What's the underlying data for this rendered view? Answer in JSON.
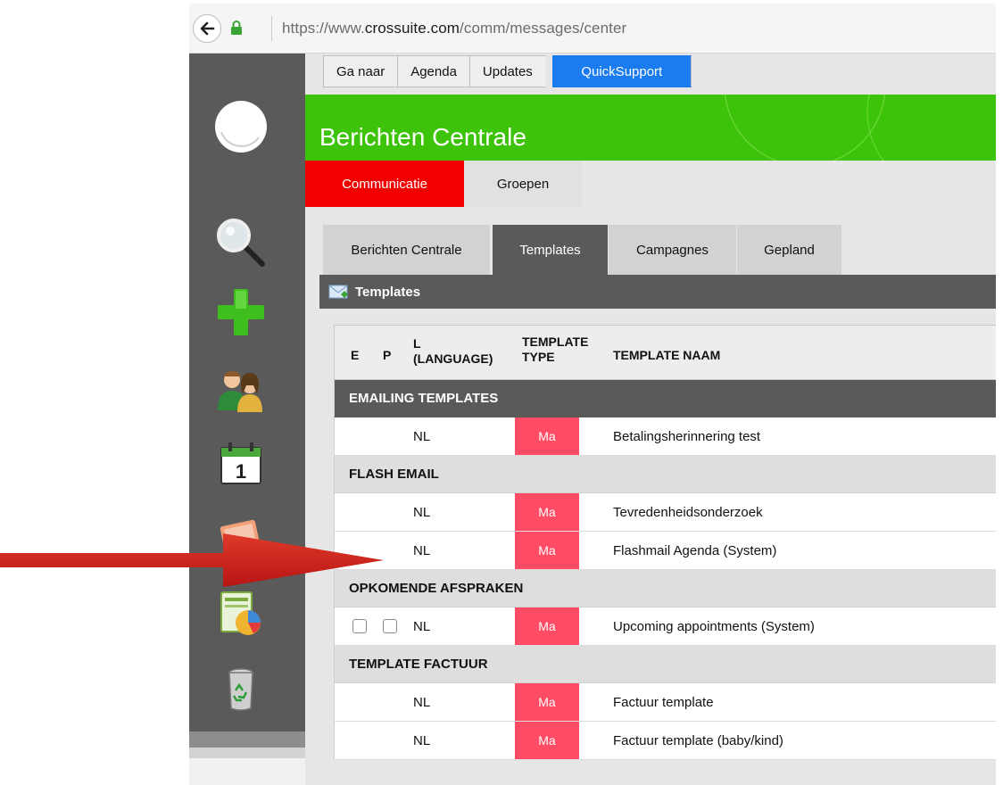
{
  "browser": {
    "url_prefix": "https://www.",
    "url_domain": "crossuite.com",
    "url_path": "/comm/messages/center"
  },
  "topmenu": {
    "items": [
      "Ga naar",
      "Agenda",
      "Updates"
    ],
    "quicksupport": "QuickSupport"
  },
  "banner": {
    "title": "Berichten Centrale"
  },
  "module_tabs": {
    "communicatie": "Communicatie",
    "groepen": "Groepen"
  },
  "sub_tabs": {
    "berichten": "Berichten Centrale",
    "templates": "Templates",
    "campagnes": "Campagnes",
    "gepland": "Gepland"
  },
  "panel": {
    "title": "Templates"
  },
  "table": {
    "headers": {
      "e": "E",
      "p": "P",
      "lang_1": "L",
      "lang_2": "(LANGUAGE)",
      "type_1": "TEMPLATE",
      "type_2": "TYPE",
      "name": "TEMPLATE NAAM"
    },
    "groups": {
      "emailing": "EMAILING TEMPLATES",
      "flash": "FLASH EMAIL",
      "opkomende": "OPKOMENDE AFSPRAKEN",
      "factuur": "TEMPLATE FACTUUR"
    },
    "rows": {
      "r1": {
        "lang": "NL",
        "type": "Ma",
        "name": "Betalingsherinnering test"
      },
      "r2": {
        "lang": "NL",
        "type": "Ma",
        "name": "Tevredenheidsonderzoek"
      },
      "r3": {
        "lang": "NL",
        "type": "Ma",
        "name": "Flashmail Agenda (System)"
      },
      "r4": {
        "lang": "NL",
        "type": "Ma",
        "name": "Upcoming appointments (System)"
      },
      "r5": {
        "lang": "NL",
        "type": "Ma",
        "name": "Factuur template"
      },
      "r6": {
        "lang": "NL",
        "type": "Ma",
        "name": "Factuur template (baby/kind)"
      }
    }
  },
  "sidebar": {
    "icons": [
      "logo-icon",
      "search-icon",
      "add-icon",
      "contacts-icon",
      "calendar-icon",
      "notes-icon",
      "reports-icon",
      "trash-icon"
    ],
    "calendar_day": "1"
  },
  "colors": {
    "accent_green": "#3ec30b",
    "active_red": "#f20000",
    "type_badge": "#ff4b63",
    "quicksupport_blue": "#1a7cf0",
    "sidebar": "#5a5a5a",
    "arrow": "#d32020"
  }
}
